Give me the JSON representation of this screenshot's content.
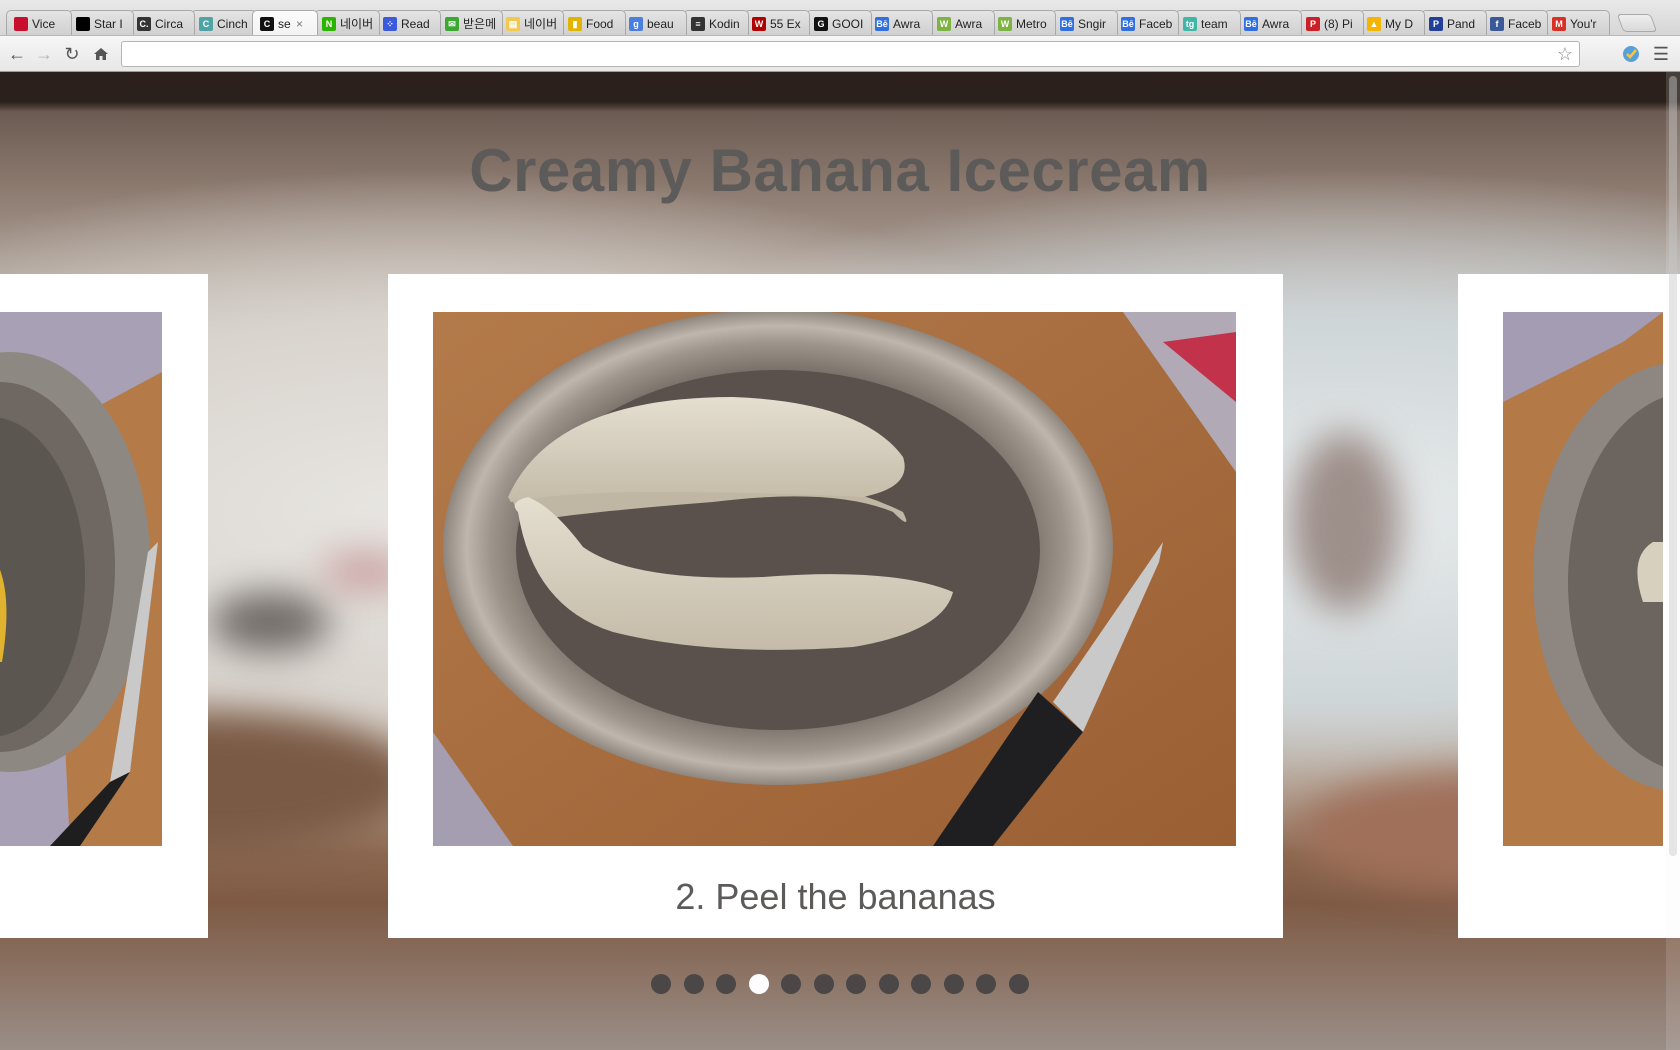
{
  "browser": {
    "tabs": [
      {
        "label": "Vice",
        "icon": "vice-favicon",
        "color": "#c8102e"
      },
      {
        "label": "Star I",
        "icon": "star-favicon",
        "color": "#000000"
      },
      {
        "label": "Circa",
        "icon": "circa-favicon",
        "color": "#333333",
        "glyph": "C."
      },
      {
        "label": "Cinch",
        "icon": "cinch-favicon",
        "color": "#4fa3a5",
        "glyph": "C"
      },
      {
        "label": "se",
        "icon": "circa-c-favicon",
        "color": "#111111",
        "glyph": "C",
        "active": true,
        "close": "×"
      },
      {
        "label": "네이버",
        "icon": "naver-favicon",
        "color": "#2db400",
        "glyph": "N"
      },
      {
        "label": "Read",
        "icon": "read-favicon",
        "color": "#3b5bdb",
        "glyph": "⁘"
      },
      {
        "label": "받은메",
        "icon": "mail-favicon",
        "color": "#3aa831",
        "glyph": "✉"
      },
      {
        "label": "네이버",
        "icon": "naver-memo-favicon",
        "color": "#f2c94c",
        "glyph": "▤"
      },
      {
        "label": "Food",
        "icon": "food-favicon",
        "color": "#e0b400",
        "glyph": "▮"
      },
      {
        "label": "beau",
        "icon": "google-favicon",
        "color": "#4a7fe0",
        "glyph": "g"
      },
      {
        "label": "Kodin",
        "icon": "kodin-favicon",
        "color": "#333333",
        "glyph": "≡"
      },
      {
        "label": "55 Ex",
        "icon": "wdl-favicon",
        "color": "#b00000",
        "glyph": "W"
      },
      {
        "label": "GOOI",
        "icon": "gooi-favicon",
        "color": "#111111",
        "glyph": "G"
      },
      {
        "label": "Awra",
        "icon": "behance-favicon",
        "color": "#2f6fe0",
        "glyph": "Bē"
      },
      {
        "label": "Awra",
        "icon": "awwwards-favicon",
        "color": "#7cb342",
        "glyph": "W"
      },
      {
        "label": "Metro",
        "icon": "metro-favicon",
        "color": "#7cb342",
        "glyph": "W"
      },
      {
        "label": "Sngir",
        "icon": "behance-favicon",
        "color": "#2f6fe0",
        "glyph": "Bē"
      },
      {
        "label": "Faceb",
        "icon": "behance-favicon",
        "color": "#2f6fe0",
        "glyph": "Bē"
      },
      {
        "label": "team",
        "icon": "tg-favicon",
        "color": "#3fb6a8",
        "glyph": "tg"
      },
      {
        "label": "Awra",
        "icon": "behance-favicon",
        "color": "#2f6fe0",
        "glyph": "Bē"
      },
      {
        "label": "(8) Pi",
        "icon": "pinterest-favicon",
        "color": "#cb2027",
        "glyph": "P"
      },
      {
        "label": "My D",
        "icon": "drive-favicon",
        "color": "#f4b400",
        "glyph": "▲"
      },
      {
        "label": "Pand",
        "icon": "pandora-favicon",
        "color": "#224099",
        "glyph": "P"
      },
      {
        "label": "Faceb",
        "icon": "facebook-favicon",
        "color": "#3b5998",
        "glyph": "f"
      },
      {
        "label": "You'r",
        "icon": "gmail-favicon",
        "color": "#d93025",
        "glyph": "M"
      }
    ],
    "address": ""
  },
  "slideshow": {
    "title": "Creamy Banana Icecream",
    "current_caption": "2. Peel the bananas",
    "slide_count": 12,
    "active_index": 3,
    "colors": {
      "card": "#ffffff",
      "text": "#5d5b5a",
      "dot": "#4a4746",
      "dot_active": "#ffffff"
    }
  }
}
